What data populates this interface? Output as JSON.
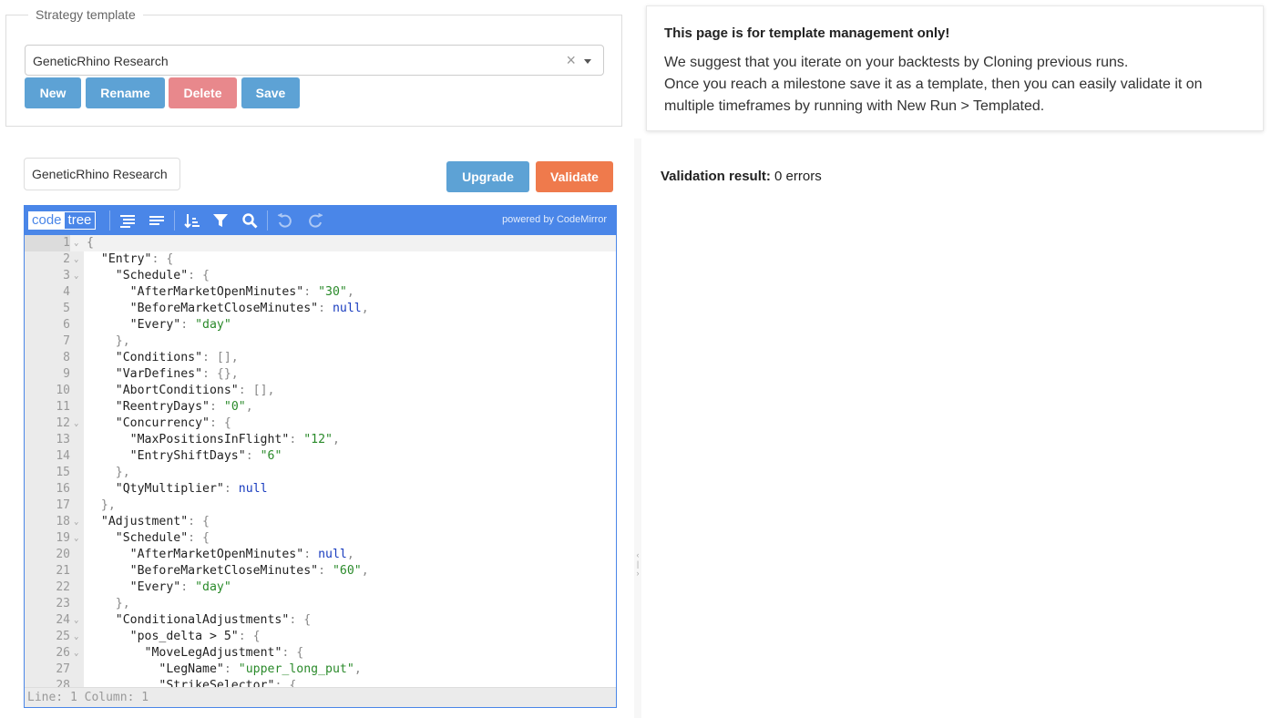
{
  "template_box": {
    "legend": "Strategy template",
    "selected": "GeneticRhino Research",
    "clear_glyph": "×",
    "buttons": {
      "new": "New",
      "rename": "Rename",
      "delete": "Delete",
      "save": "Save"
    }
  },
  "info": {
    "title": "This page is for template management only!",
    "lines": [
      "We suggest that you iterate on your backtests by Cloning previous runs.",
      "Once you reach a milestone save it as a template, then you can easily validate it on multiple timeframes by running with New Run > Templated."
    ]
  },
  "name_input": {
    "value": "GeneticRhino Research"
  },
  "actions": {
    "upgrade": "Upgrade",
    "validate": "Validate"
  },
  "editor": {
    "modes": {
      "code": "code",
      "tree": "tree"
    },
    "powered_by": "powered by CodeMirror",
    "icons": [
      "format-icon",
      "compact-icon",
      "sort-icon",
      "filter-icon",
      "search-icon",
      "undo-icon",
      "redo-icon"
    ],
    "status": "Line: 1  Column: 1",
    "lines": [
      [
        [
          "p",
          "{"
        ]
      ],
      [
        [
          "p",
          "  "
        ],
        [
          "k",
          "\"Entry\""
        ],
        [
          "p",
          ": {"
        ]
      ],
      [
        [
          "p",
          "    "
        ],
        [
          "k",
          "\"Schedule\""
        ],
        [
          "p",
          ": {"
        ]
      ],
      [
        [
          "p",
          "      "
        ],
        [
          "k",
          "\"AfterMarketOpenMinutes\""
        ],
        [
          "p",
          ": "
        ],
        [
          "s",
          "\"30\""
        ],
        [
          "p",
          ","
        ]
      ],
      [
        [
          "p",
          "      "
        ],
        [
          "k",
          "\"BeforeMarketCloseMinutes\""
        ],
        [
          "p",
          ": "
        ],
        [
          "n",
          "null"
        ],
        [
          "p",
          ","
        ]
      ],
      [
        [
          "p",
          "      "
        ],
        [
          "k",
          "\"Every\""
        ],
        [
          "p",
          ": "
        ],
        [
          "s",
          "\"day\""
        ]
      ],
      [
        [
          "p",
          "    },"
        ]
      ],
      [
        [
          "p",
          "    "
        ],
        [
          "k",
          "\"Conditions\""
        ],
        [
          "p",
          ": [],"
        ]
      ],
      [
        [
          "p",
          "    "
        ],
        [
          "k",
          "\"VarDefines\""
        ],
        [
          "p",
          ": {},"
        ]
      ],
      [
        [
          "p",
          "    "
        ],
        [
          "k",
          "\"AbortConditions\""
        ],
        [
          "p",
          ": [],"
        ]
      ],
      [
        [
          "p",
          "    "
        ],
        [
          "k",
          "\"ReentryDays\""
        ],
        [
          "p",
          ": "
        ],
        [
          "s",
          "\"0\""
        ],
        [
          "p",
          ","
        ]
      ],
      [
        [
          "p",
          "    "
        ],
        [
          "k",
          "\"Concurrency\""
        ],
        [
          "p",
          ": {"
        ]
      ],
      [
        [
          "p",
          "      "
        ],
        [
          "k",
          "\"MaxPositionsInFlight\""
        ],
        [
          "p",
          ": "
        ],
        [
          "s",
          "\"12\""
        ],
        [
          "p",
          ","
        ]
      ],
      [
        [
          "p",
          "      "
        ],
        [
          "k",
          "\"EntryShiftDays\""
        ],
        [
          "p",
          ": "
        ],
        [
          "s",
          "\"6\""
        ]
      ],
      [
        [
          "p",
          "    },"
        ]
      ],
      [
        [
          "p",
          "    "
        ],
        [
          "k",
          "\"QtyMultiplier\""
        ],
        [
          "p",
          ": "
        ],
        [
          "n",
          "null"
        ]
      ],
      [
        [
          "p",
          "  },"
        ]
      ],
      [
        [
          "p",
          "  "
        ],
        [
          "k",
          "\"Adjustment\""
        ],
        [
          "p",
          ": {"
        ]
      ],
      [
        [
          "p",
          "    "
        ],
        [
          "k",
          "\"Schedule\""
        ],
        [
          "p",
          ": {"
        ]
      ],
      [
        [
          "p",
          "      "
        ],
        [
          "k",
          "\"AfterMarketOpenMinutes\""
        ],
        [
          "p",
          ": "
        ],
        [
          "n",
          "null"
        ],
        [
          "p",
          ","
        ]
      ],
      [
        [
          "p",
          "      "
        ],
        [
          "k",
          "\"BeforeMarketCloseMinutes\""
        ],
        [
          "p",
          ": "
        ],
        [
          "s",
          "\"60\""
        ],
        [
          "p",
          ","
        ]
      ],
      [
        [
          "p",
          "      "
        ],
        [
          "k",
          "\"Every\""
        ],
        [
          "p",
          ": "
        ],
        [
          "s",
          "\"day\""
        ]
      ],
      [
        [
          "p",
          "    },"
        ]
      ],
      [
        [
          "p",
          "    "
        ],
        [
          "k",
          "\"ConditionalAdjustments\""
        ],
        [
          "p",
          ": {"
        ]
      ],
      [
        [
          "p",
          "      "
        ],
        [
          "k",
          "\"pos_delta > 5\""
        ],
        [
          "p",
          ": {"
        ]
      ],
      [
        [
          "p",
          "        "
        ],
        [
          "k",
          "\"MoveLegAdjustment\""
        ],
        [
          "p",
          ": {"
        ]
      ],
      [
        [
          "p",
          "          "
        ],
        [
          "k",
          "\"LegName\""
        ],
        [
          "p",
          ": "
        ],
        [
          "s",
          "\"upper_long_put\""
        ],
        [
          "p",
          ","
        ]
      ],
      [
        [
          "p",
          "          "
        ],
        [
          "k",
          "\"StrikeSelector\""
        ],
        [
          "p",
          ": {"
        ]
      ]
    ],
    "foldable": [
      1,
      2,
      3,
      12,
      18,
      19,
      24,
      25,
      26
    ]
  },
  "validation": {
    "label": "Validation result:",
    "value": "0 errors"
  },
  "colors": {
    "accent": "#4a86e8",
    "button_blue": "#5da2d5",
    "button_red": "#e8888c",
    "button_orange": "#ef7a4c"
  }
}
